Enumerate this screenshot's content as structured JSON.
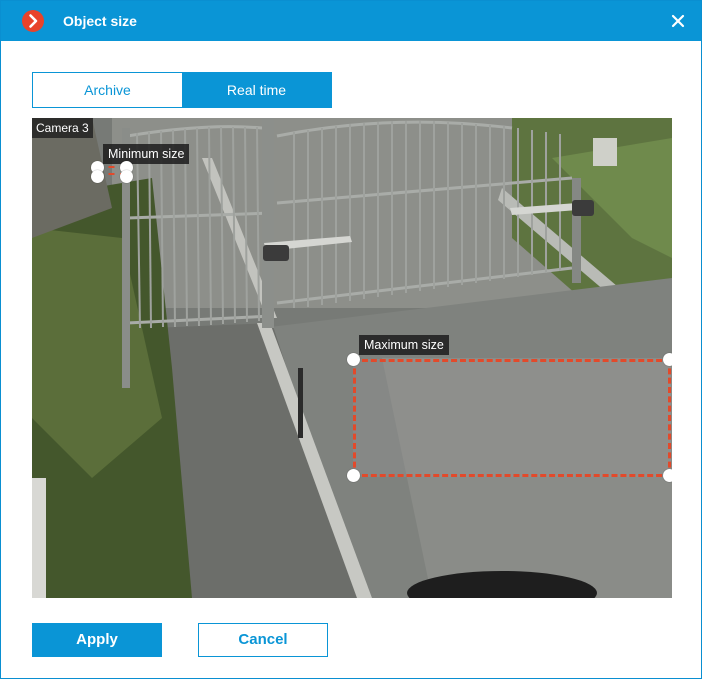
{
  "window": {
    "title": "Object size"
  },
  "tabs": [
    {
      "label": "Archive",
      "selected": false
    },
    {
      "label": "Real time",
      "selected": true
    }
  ],
  "camera": {
    "label": "Camera 3"
  },
  "regions": {
    "minimum": {
      "label": "Minimum size"
    },
    "maximum": {
      "label": "Maximum size"
    }
  },
  "buttons": {
    "apply": "Apply",
    "cancel": "Cancel"
  },
  "colors": {
    "accent": "#0a95d6",
    "logo": "#e8432b",
    "region_border": "#e24a2b"
  },
  "icons": {
    "logo": "chevron-right-icon",
    "close": "close-icon"
  }
}
